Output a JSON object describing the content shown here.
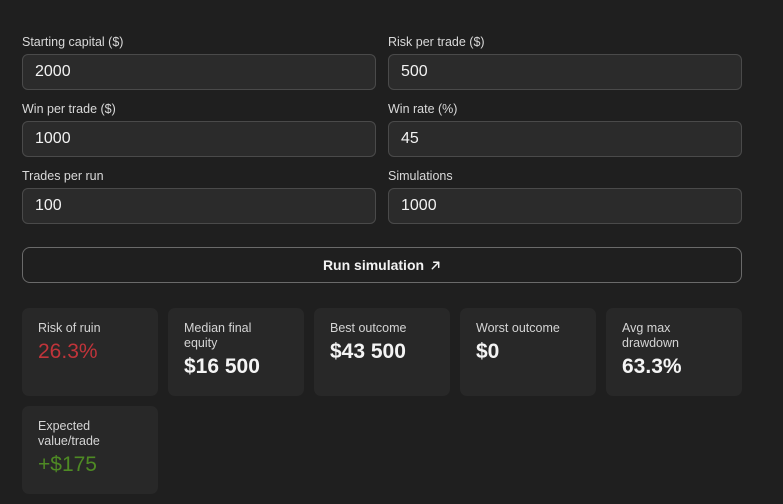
{
  "form": {
    "starting_capital": {
      "label": "Starting capital ($)",
      "value": "2000"
    },
    "risk_per_trade": {
      "label": "Risk per trade ($)",
      "value": "500"
    },
    "win_per_trade": {
      "label": "Win per trade ($)",
      "value": "1000"
    },
    "win_rate": {
      "label": "Win rate (%)",
      "value": "45"
    },
    "trades_per_run": {
      "label": "Trades per run",
      "value": "100"
    },
    "simulations": {
      "label": "Simulations",
      "value": "1000"
    }
  },
  "run_button": {
    "label": "Run simulation",
    "icon": "arrow-up-right-icon"
  },
  "results": {
    "risk_of_ruin": {
      "label": "Risk of ruin",
      "value": "26.3%",
      "color": "#c0343a"
    },
    "median_final_equity": {
      "label": "Median final equity",
      "value": "$16 500"
    },
    "best_outcome": {
      "label": "Best outcome",
      "value": "$43 500"
    },
    "worst_outcome": {
      "label": "Worst outcome",
      "value": "$0"
    },
    "avg_max_drawdown": {
      "label": "Avg max drawdown",
      "value": "63.3%"
    },
    "expected_value": {
      "label": "Expected value/trade",
      "value": "+$175",
      "color": "#4e8a24"
    }
  }
}
